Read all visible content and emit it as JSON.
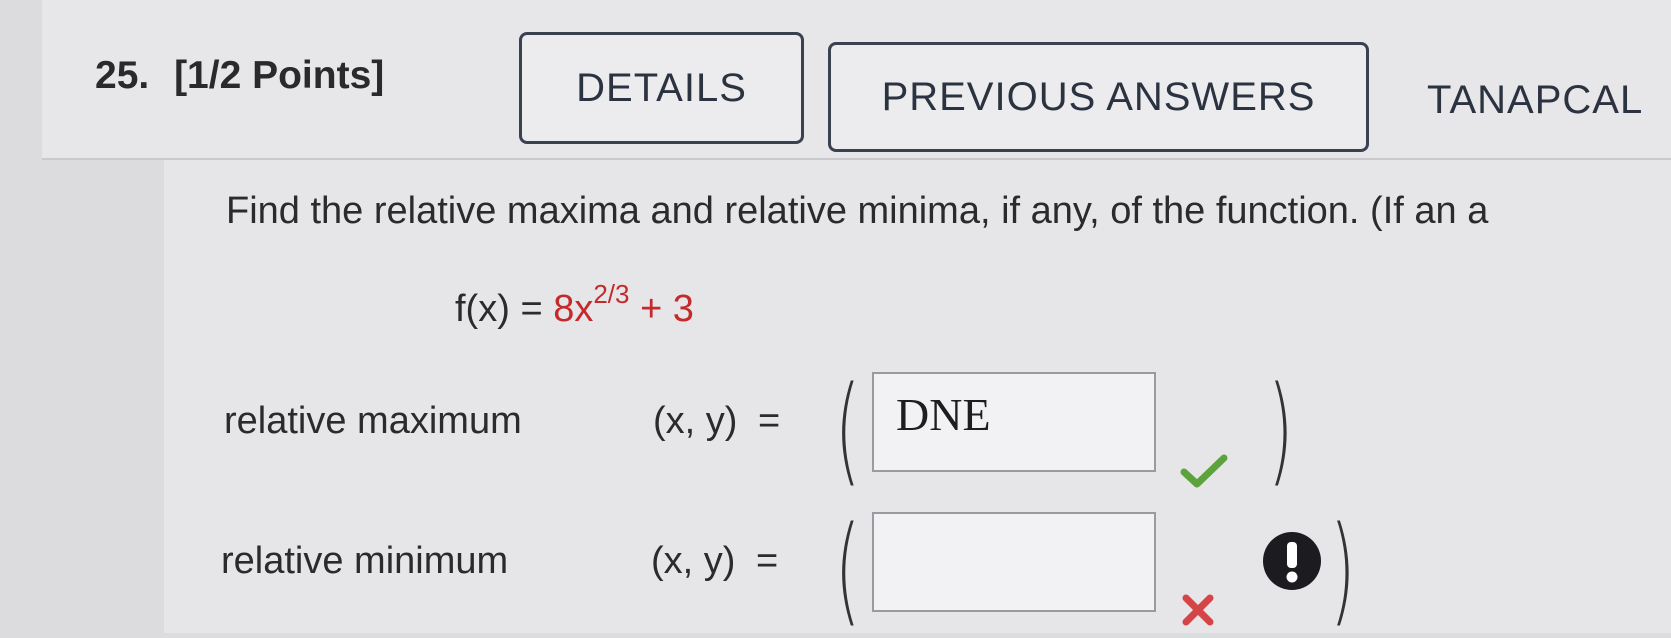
{
  "question": {
    "number": "25.",
    "points": "[1/2 Points]",
    "details_label": "DETAILS",
    "previous_answers_label": "PREVIOUS ANSWERS",
    "source_label": "TANAPCAL"
  },
  "problem": {
    "instruction": "Find the relative maxima and relative minima, if any, of the function. (If an a",
    "function_lhs": "f(x)",
    "equals": "=",
    "coefficient": "8x",
    "exponent": "2/3",
    "constant": "+ 3"
  },
  "answers": {
    "max_label": "relative maximum",
    "min_label": "relative minimum",
    "xy_label": "(x, y)",
    "eq": "=",
    "open_paren": "(",
    "close_paren": ")",
    "max_value": "DNE",
    "min_value": ""
  },
  "status": {
    "max": "correct",
    "min": "incorrect",
    "correct_color": "#5ba33a",
    "incorrect_color": "#d64545",
    "alert_icon": "exclamation-icon"
  }
}
